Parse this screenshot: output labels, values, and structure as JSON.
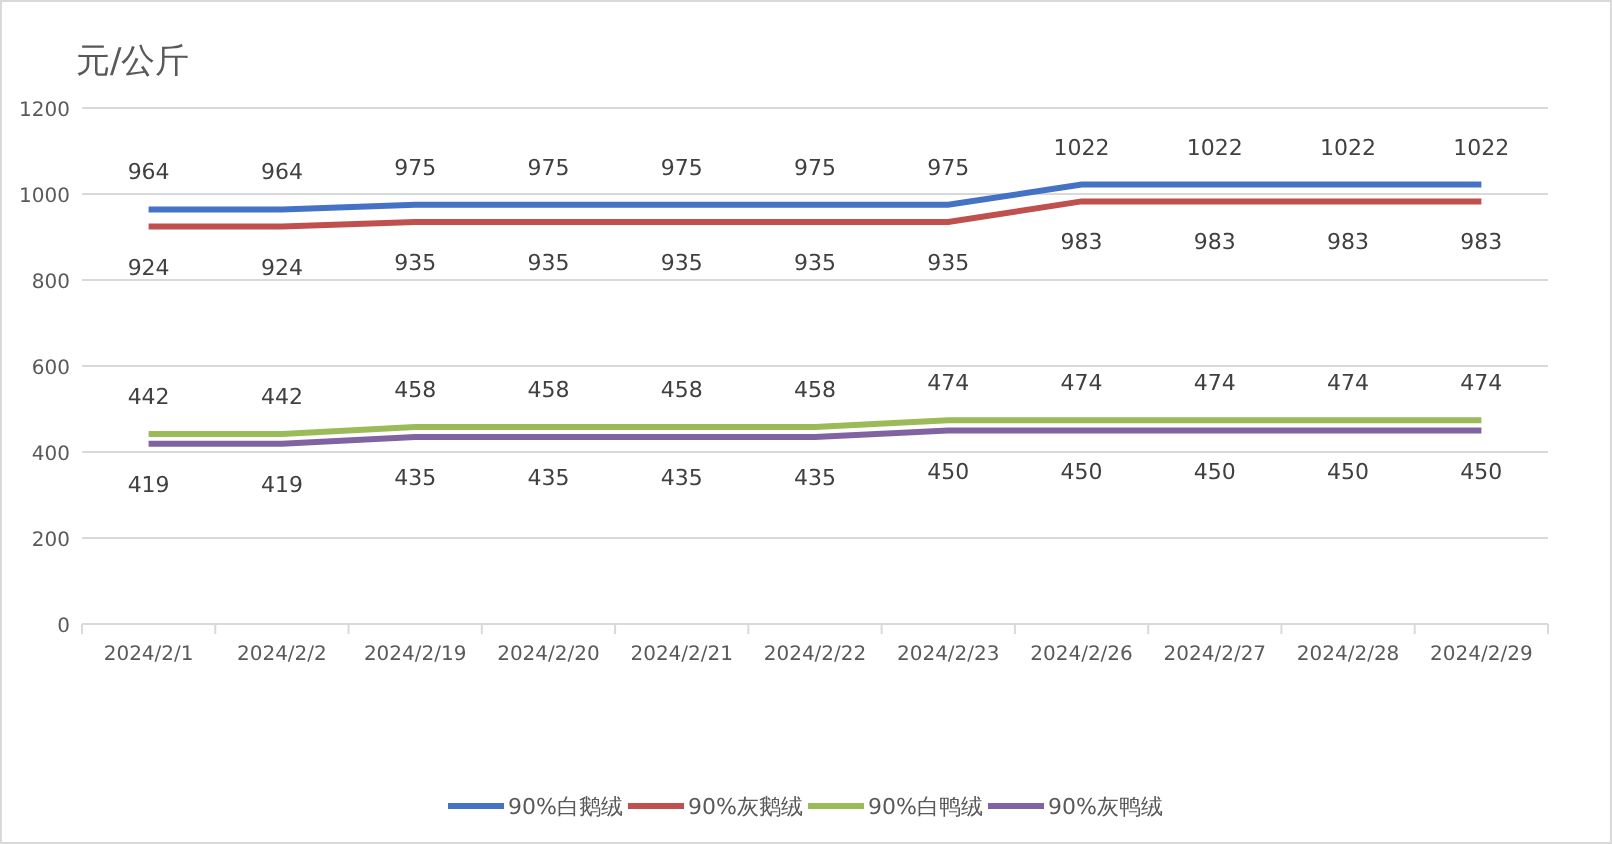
{
  "chart_data": {
    "type": "line",
    "ylabel": "元/公斤",
    "categories": [
      "2024/2/1",
      "2024/2/2",
      "2024/2/19",
      "2024/2/20",
      "2024/2/21",
      "2024/2/22",
      "2024/2/23",
      "2024/2/26",
      "2024/2/27",
      "2024/2/28",
      "2024/2/29"
    ],
    "series": [
      {
        "name": "90%白鹅绒",
        "color": "#4472c4",
        "values": [
          964,
          964,
          975,
          975,
          975,
          975,
          975,
          1022,
          1022,
          1022,
          1022
        ]
      },
      {
        "name": "90%灰鹅绒",
        "color": "#c0504d",
        "values": [
          924,
          924,
          935,
          935,
          935,
          935,
          935,
          983,
          983,
          983,
          983
        ]
      },
      {
        "name": "90%白鸭绒",
        "color": "#9bbb59",
        "values": [
          442,
          442,
          458,
          458,
          458,
          458,
          474,
          474,
          474,
          474,
          474
        ]
      },
      {
        "name": "90%灰鸭绒",
        "color": "#8064a2",
        "values": [
          419,
          419,
          435,
          435,
          435,
          435,
          450,
          450,
          450,
          450,
          450
        ]
      }
    ],
    "ylim": [
      0,
      1200
    ],
    "yticks": [
      0,
      200,
      400,
      600,
      800,
      1000,
      1200
    ],
    "data_labels": true,
    "grid": true,
    "legend": "bottom"
  }
}
